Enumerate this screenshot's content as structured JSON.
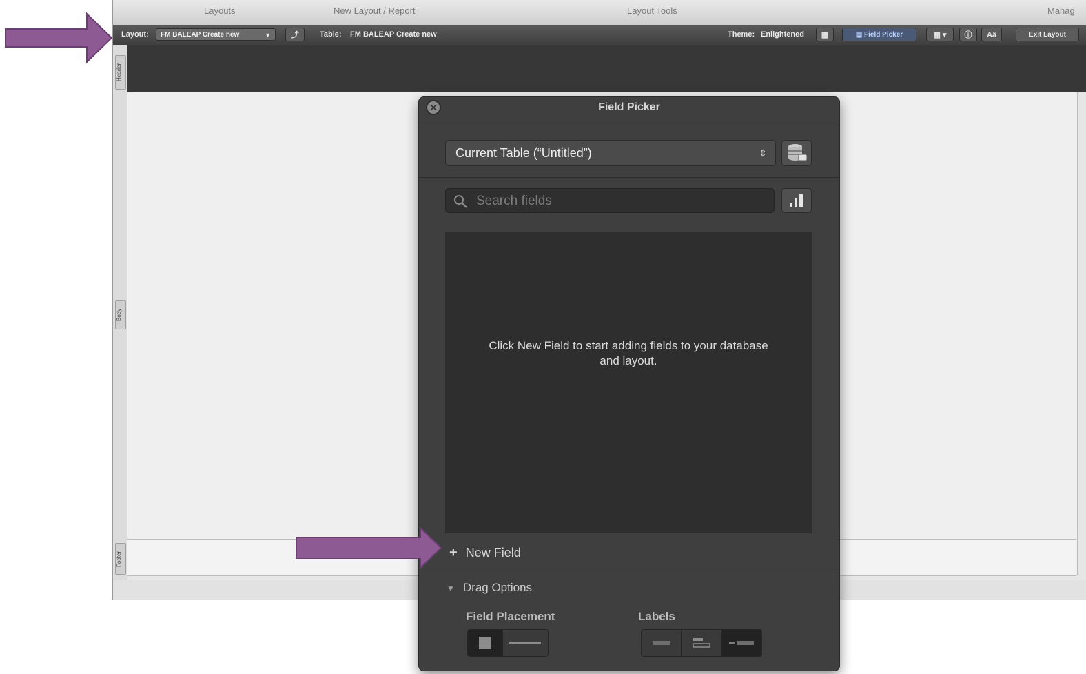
{
  "toolbar_tabs": {
    "layouts": "Layouts",
    "new_layout_report": "New Layout / Report",
    "layout_tools": "Layout Tools",
    "manage": "Manag"
  },
  "layout_bar": {
    "layout_label": "Layout:",
    "layout_value": "FM BALEAP Create new",
    "table_label": "Table:",
    "table_value": "FM BALEAP Create new",
    "theme_label": "Theme:",
    "theme_value": "Enlightened",
    "field_picker_label": "Field Picker",
    "aa_label": "Aâ",
    "exit_layout_label": "Exit Layout"
  },
  "parts": {
    "header": "Header",
    "body": "Body",
    "footer": "Footer"
  },
  "field_picker": {
    "title": "Field Picker",
    "table_selector": "Current Table (“Untitled”)",
    "search_placeholder": "Search fields",
    "empty_message": "Click New Field to start adding fields to your database and layout.",
    "new_field_label": "New Field",
    "drag_options_label": "Drag Options",
    "field_placement_label": "Field Placement",
    "labels_label": "Labels"
  },
  "colors": {
    "arrow_fill": "#8e5a94",
    "arrow_stroke": "#6a3e72",
    "panel_bg": "#3f3f3f"
  }
}
